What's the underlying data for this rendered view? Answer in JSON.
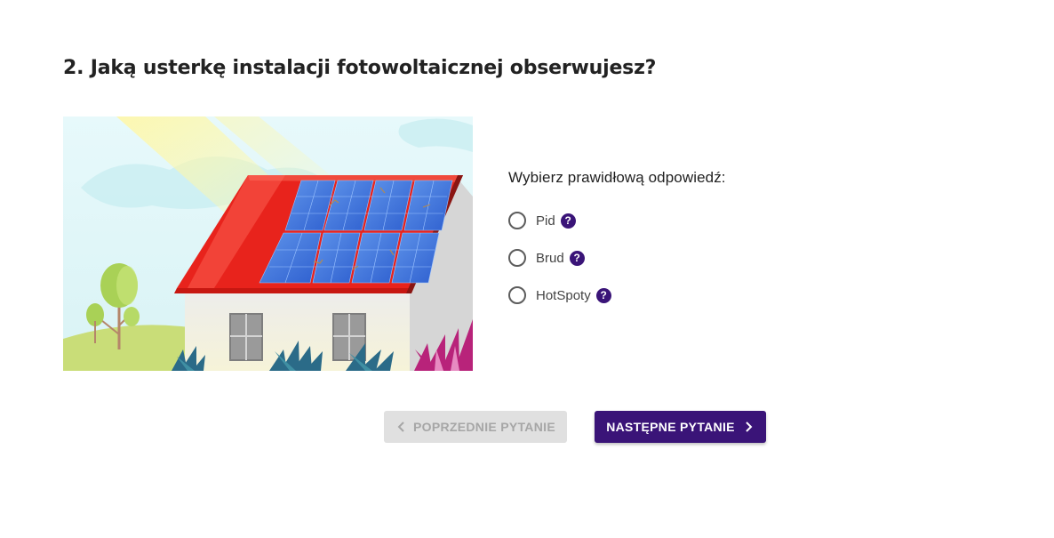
{
  "question": {
    "title": "2. Jaką usterkę instalacji fotowoltaicznej obserwujesz?"
  },
  "illustration": {
    "icon": "house-with-solar-panels-illustration",
    "colors": {
      "sky": "#dff6f8",
      "roof": "#e8231c",
      "panel": "#3b73d9",
      "wall": "#f3f2e8",
      "grass": "#c6dc74"
    }
  },
  "answers": {
    "prompt": "Wybierz prawidłową odpowiedź:",
    "options": [
      {
        "label": "Pid",
        "help_icon": "question-mark-icon",
        "help_glyph": "?"
      },
      {
        "label": "Brud",
        "help_icon": "question-mark-icon",
        "help_glyph": "?"
      },
      {
        "label": "HotSpoty",
        "help_icon": "question-mark-icon",
        "help_glyph": "?"
      }
    ]
  },
  "navigation": {
    "prev_label": "POPRZEDNIE PYTANIE",
    "next_label": "NASTĘPNE PYTANIE"
  },
  "colors": {
    "accent": "#3a1478",
    "disabled_bg": "#e0e0e0",
    "disabled_text": "#a6a6a6"
  }
}
